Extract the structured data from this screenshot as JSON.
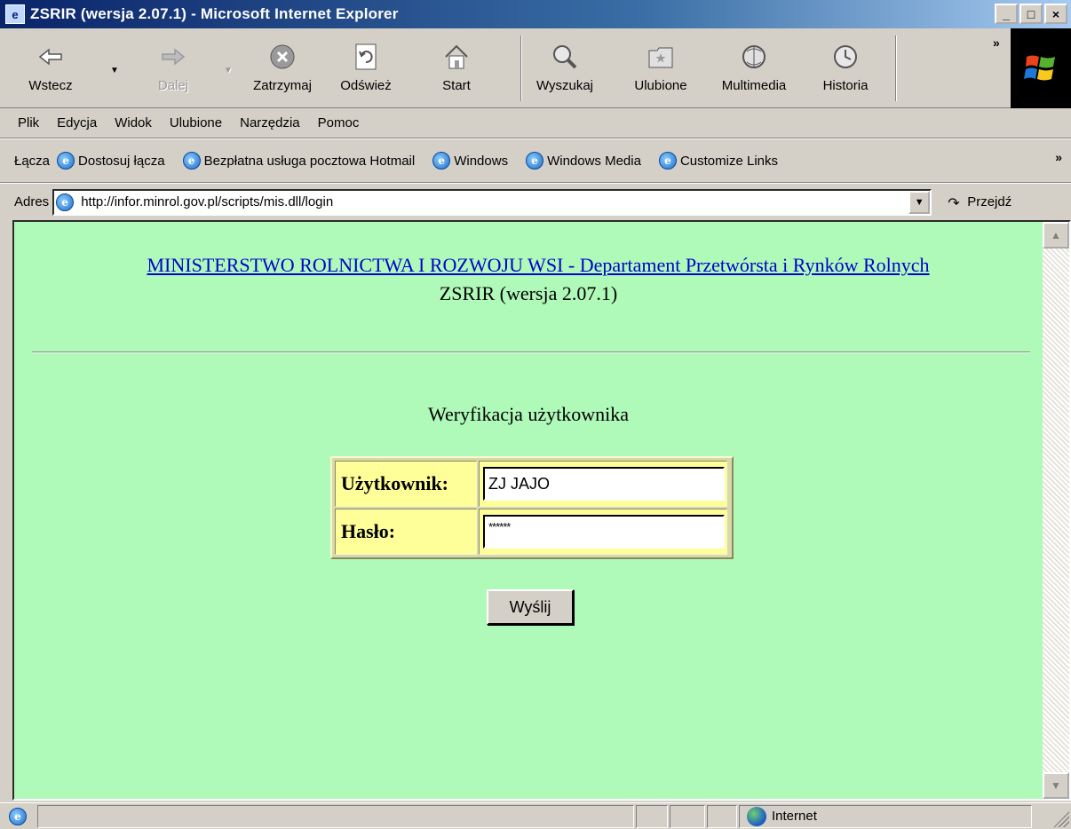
{
  "window": {
    "title": "ZSRIR (wersja 2.07.1) - Microsoft Internet Explorer",
    "btn_min": "_",
    "btn_max": "□",
    "btn_close": "×"
  },
  "toolbar": {
    "back": "Wstecz",
    "forward": "Dalej",
    "stop": "Zatrzymaj",
    "refresh": "Odśwież",
    "home": "Start",
    "search": "Wyszukaj",
    "favorites": "Ulubione",
    "media": "Multimedia",
    "history": "Historia",
    "chevron": "»"
  },
  "menu": {
    "items": [
      "Plik",
      "Edycja",
      "Widok",
      "Ulubione",
      "Narzędzia",
      "Pomoc"
    ]
  },
  "links": {
    "label": "Łącza",
    "items": [
      "Dostosuj łącza",
      "Bezpłatna usługa pocztowa Hotmail",
      "Windows",
      "Windows Media",
      "Customize Links"
    ],
    "chevron": "»"
  },
  "address": {
    "label": "Adres",
    "url": "http://infor.minrol.gov.pl/scripts/mis.dll/login",
    "go": "Przejdź"
  },
  "page": {
    "ministry_link": "MINISTERSTWO ROLNICTWA I ROZWOJU WSI - Departament Przetwórsta i Rynków Rolnych",
    "version": "ZSRIR (wersja 2.07.1)",
    "verify_title": "Weryfikacja użytkownika",
    "user_label": "Użytkownik:",
    "user_value": "ZJ JAJO",
    "pass_label": "Hasło:",
    "pass_value": "******",
    "submit": "Wyślij"
  },
  "status": {
    "zone": "Internet"
  },
  "colors": {
    "page_bg": "#b0fab9",
    "label_bg": "#ffff99",
    "link": "#0000cc"
  }
}
